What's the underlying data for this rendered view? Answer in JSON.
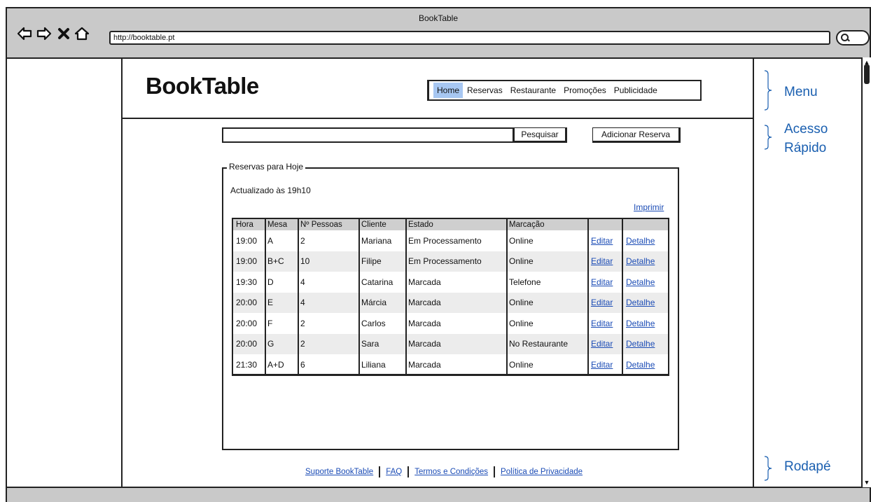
{
  "browser": {
    "title": "BookTable",
    "url": "http://booktable.pt"
  },
  "header": {
    "logo": "BookTable",
    "menu": [
      {
        "label": "Home",
        "active": true
      },
      {
        "label": "Reservas",
        "active": false
      },
      {
        "label": "Restaurante",
        "active": false
      },
      {
        "label": "Promoções",
        "active": false
      },
      {
        "label": "Publicidade",
        "active": false
      }
    ]
  },
  "quick_access": {
    "search_value": "",
    "search_button": "Pesquisar",
    "add_button": "Adicionar Reserva"
  },
  "reservations": {
    "group_title": "Reservas para Hoje",
    "updated": "Actualizado às 19h10",
    "print_link": "Imprimir",
    "columns": [
      "Hora",
      "Mesa",
      "Nº Pessoas",
      "Cliente",
      "Estado",
      "Marcação",
      "",
      ""
    ],
    "rows": [
      {
        "hora": "19:00",
        "mesa": "A",
        "pessoas": "2",
        "cliente": "Mariana",
        "estado": "Em Processamento",
        "marcacao": "Online",
        "editar": "Editar",
        "detalhe": "Detalhe"
      },
      {
        "hora": "19:00",
        "mesa": "B+C",
        "pessoas": "10",
        "cliente": "Filipe",
        "estado": "Em Processamento",
        "marcacao": "Online",
        "editar": "Editar",
        "detalhe": "Detalhe"
      },
      {
        "hora": "19:30",
        "mesa": "D",
        "pessoas": "4",
        "cliente": "Catarina",
        "estado": "Marcada",
        "marcacao": "Telefone",
        "editar": "Editar",
        "detalhe": "Detalhe"
      },
      {
        "hora": "20:00",
        "mesa": "E",
        "pessoas": "4",
        "cliente": "Márcia",
        "estado": "Marcada",
        "marcacao": "Online",
        "editar": "Editar",
        "detalhe": "Detalhe"
      },
      {
        "hora": "20:00",
        "mesa": "F",
        "pessoas": "2",
        "cliente": "Carlos",
        "estado": "Marcada",
        "marcacao": "Online",
        "editar": "Editar",
        "detalhe": "Detalhe"
      },
      {
        "hora": "20:00",
        "mesa": "G",
        "pessoas": "2",
        "cliente": "Sara",
        "estado": "Marcada",
        "marcacao": "No Restaurante",
        "editar": "Editar",
        "detalhe": "Detalhe"
      },
      {
        "hora": "21:30",
        "mesa": "A+D",
        "pessoas": "6",
        "cliente": "Liliana",
        "estado": "Marcada",
        "marcacao": "Online",
        "editar": "Editar",
        "detalhe": "Detalhe"
      }
    ]
  },
  "footer": {
    "links": [
      "Suporte BookTable",
      "FAQ",
      "Termos e Condições",
      "Política de Privacidade"
    ]
  },
  "annotations": {
    "menu": "Menu",
    "quick_access_line1": "Acesso",
    "quick_access_line2": "Rápido",
    "footer": "Rodapé"
  },
  "icons": {
    "back": "arrow-left-icon",
    "forward": "arrow-right-icon",
    "stop": "close-icon",
    "home": "home-icon",
    "search": "search-icon"
  },
  "colors": {
    "menu_active": "#a7c7f2",
    "link": "#1a4bb5",
    "annotation": "#1a5fb0",
    "browser_chrome": "#c9c9c9"
  }
}
